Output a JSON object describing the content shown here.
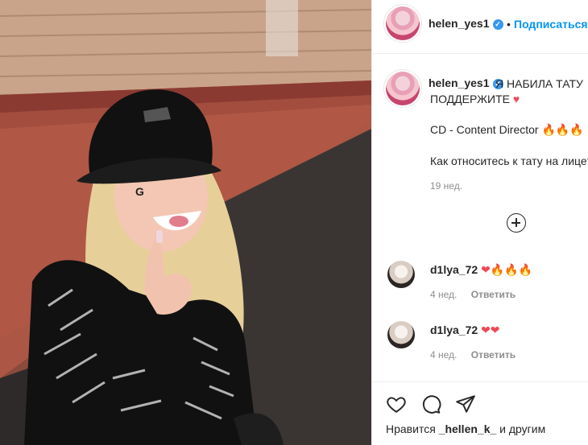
{
  "post": {
    "username": "helen_yes1",
    "verified_mark": "✓",
    "follow_separator": "•",
    "follow_label": "Подписаться",
    "caption_line1": "Я НАБИЛА ТАТУ",
    "caption_line2": "ПОДДЕРЖИТЕ",
    "caption_heart": "♥",
    "caption_line3": "CD - Content Director",
    "caption_fire": "🔥🔥🔥",
    "caption_line4": "Как относитесь к тату на лице?",
    "age": "19 нед.",
    "load_more_icon": "plus-circle-icon"
  },
  "comments": [
    {
      "user": "d1lya_72",
      "text": "❤🔥🔥🔥",
      "age": "4 нед.",
      "reply": "Ответить"
    },
    {
      "user": "d1lya_72",
      "text": "❤❤",
      "age": "4 нед.",
      "reply": "Ответить"
    }
  ],
  "actions": {
    "icons": [
      "heart-icon",
      "comment-icon",
      "share-icon"
    ],
    "likes_prefix": "Нравится",
    "likes_user": "_hellen_k_",
    "likes_suffix": "и другим"
  },
  "colors": {
    "link_blue": "#0095f6",
    "heart_red": "#ed4956",
    "muted": "#8e8e8e"
  }
}
